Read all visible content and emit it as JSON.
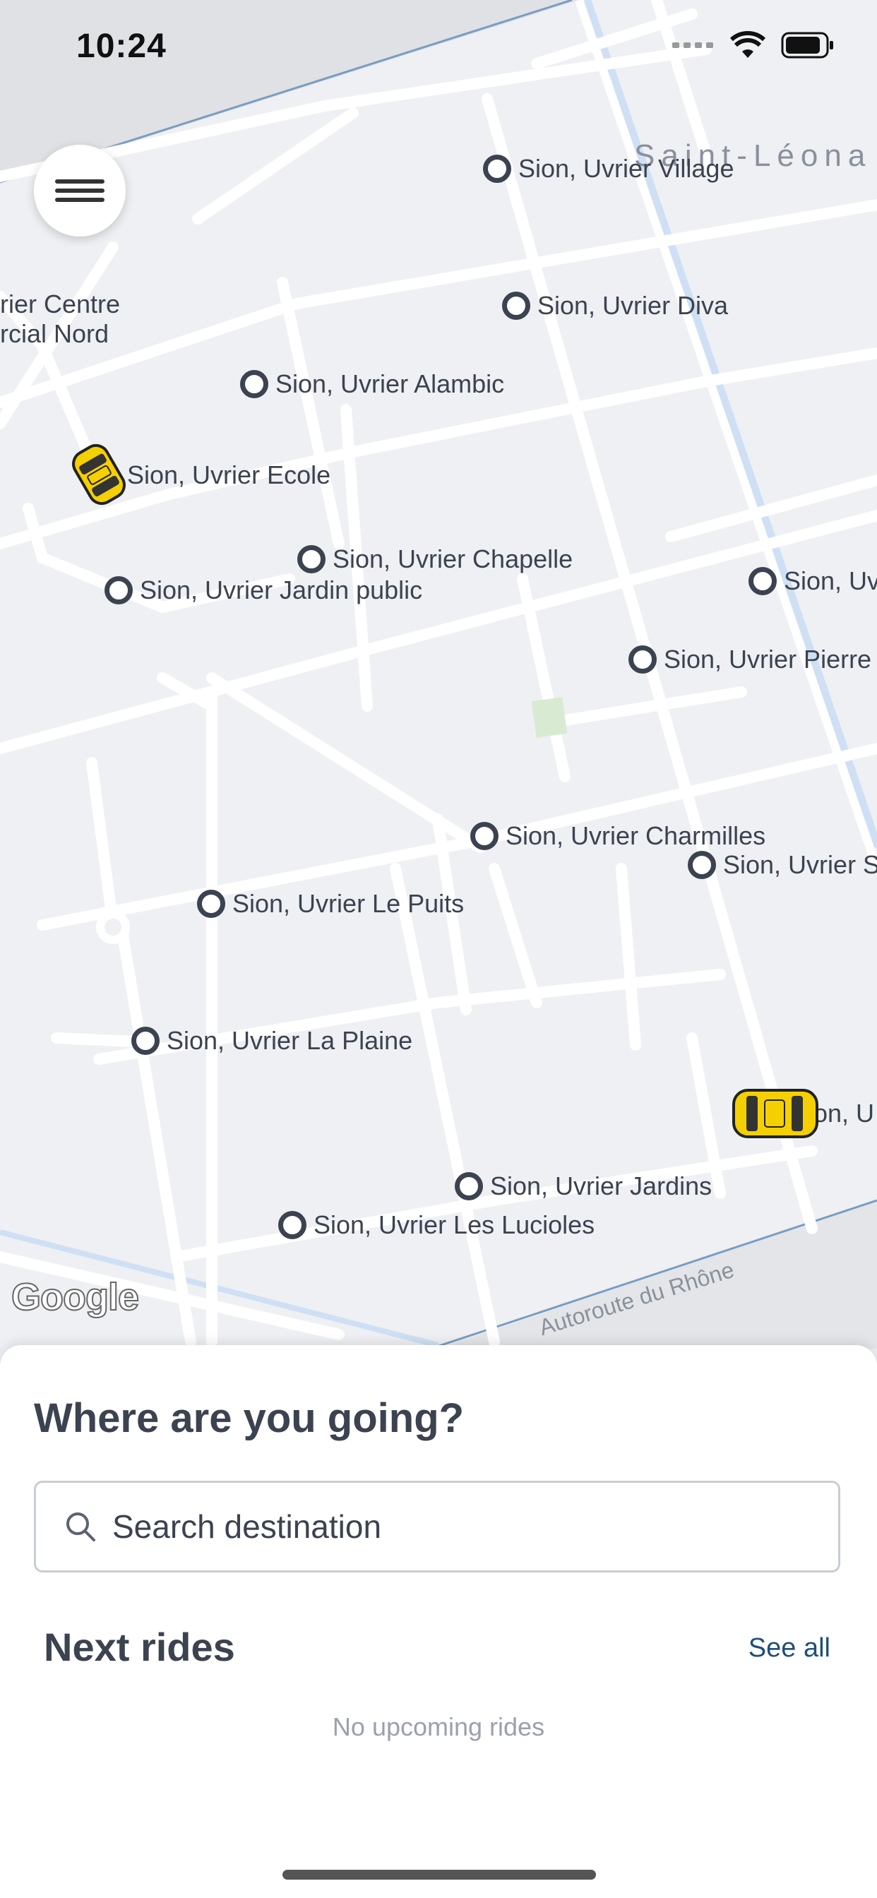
{
  "status_bar": {
    "time": "10:24"
  },
  "map": {
    "area_label": "Saint-Léona",
    "road_label": "Autoroute du Rhône",
    "attribution": "Google",
    "stops": [
      "Sion, Uvrier Village",
      "Sion, Uvrier Diva",
      "Sion, Uvrier Alambic",
      "Sion, Uvrier Ecole",
      "Sion, Uvrier Chapelle",
      "Sion, Uvrier Jardin public",
      "Sion, Uv",
      "Sion, Uvrier Pierre",
      "Sion, Uvrier Charmilles",
      "Sion, Uvrier S",
      "Sion, Uvrier Le Puits",
      "Sion, Uvrier La Plaine",
      "Sion, Uvrier Jardins",
      "Sion, Uvrier Les Lucioles",
      "on, U"
    ],
    "partial_label_lines": [
      "rier Centre",
      "rcial Nord"
    ],
    "icons": [
      "menu-icon",
      "taxi-car-icon",
      "stop-marker-icon",
      "search-icon",
      "wifi-icon",
      "battery-icon",
      "signal-icon"
    ]
  },
  "sheet": {
    "title": "Where are you going?",
    "search_placeholder": "Search destination",
    "next_rides_title": "Next rides",
    "see_all": "See all",
    "empty_state": "No upcoming rides"
  }
}
